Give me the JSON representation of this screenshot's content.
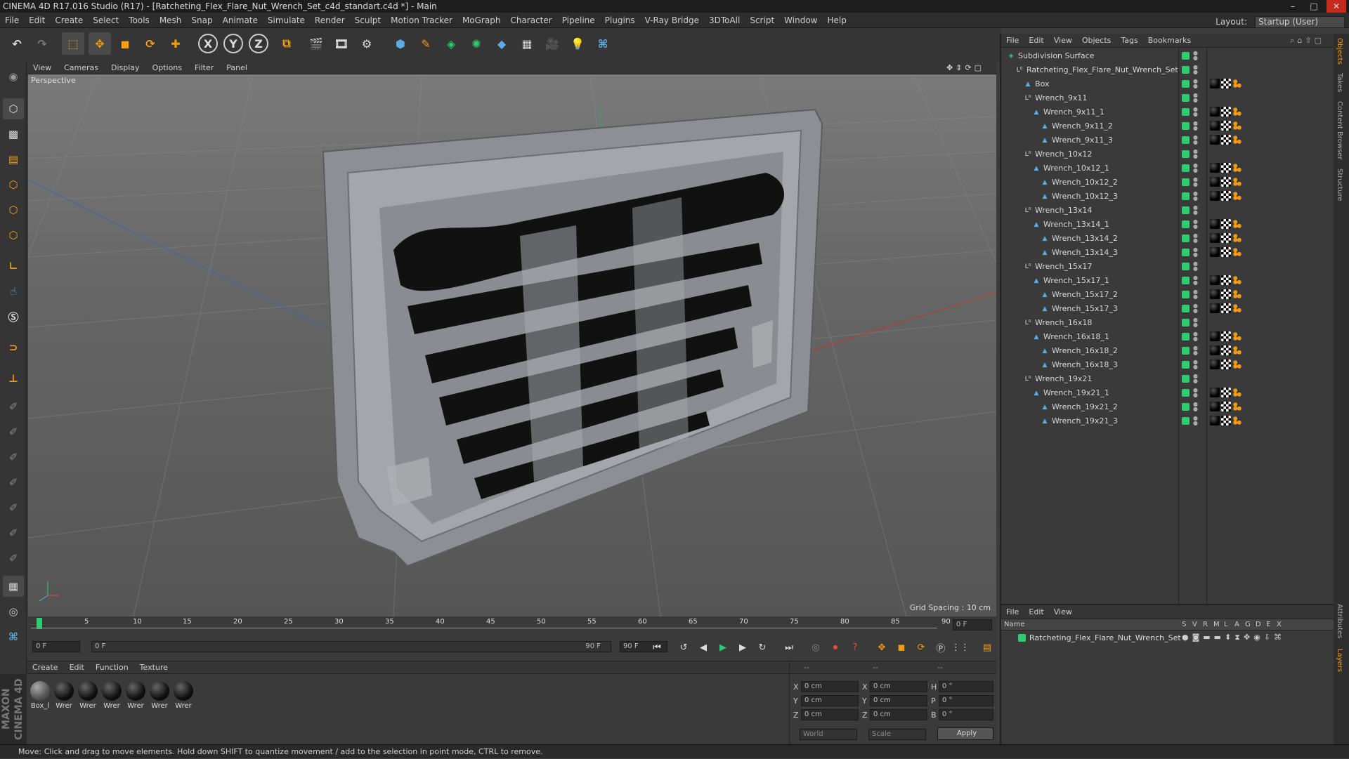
{
  "window": {
    "title": "CINEMA 4D R17.016 Studio (R17) - [Ratcheting_Flex_Flare_Nut_Wrench_Set_c4d_standart.c4d *] - Main",
    "controls": [
      "–",
      "□",
      "✕"
    ]
  },
  "menubar": {
    "items": [
      "File",
      "Edit",
      "Create",
      "Select",
      "Tools",
      "Mesh",
      "Snap",
      "Animate",
      "Simulate",
      "Render",
      "Sculpt",
      "Motion Tracker",
      "MoGraph",
      "Character",
      "Pipeline",
      "Plugins",
      "V-Ray Bridge",
      "3DToAll",
      "Script",
      "Window",
      "Help"
    ],
    "layout_label": "Layout:",
    "layout_value": "Startup (User)"
  },
  "toolbar": {
    "axis_x": "X",
    "axis_y": "Y",
    "axis_z": "Z"
  },
  "viewport": {
    "menu": [
      "View",
      "Cameras",
      "Display",
      "Options",
      "Filter",
      "Panel"
    ],
    "label": "Perspective",
    "grid_spacing": "Grid Spacing : 10 cm"
  },
  "timeline": {
    "ticks": [
      "0",
      "5",
      "10",
      "15",
      "20",
      "25",
      "30",
      "35",
      "40",
      "45",
      "50",
      "55",
      "60",
      "65",
      "70",
      "75",
      "80",
      "85",
      "90"
    ],
    "current_frame": "0 F",
    "start_field": "0 F",
    "range_start": "0 F",
    "range_end": "90 F",
    "end_field": "90 F"
  },
  "material_panel": {
    "menu": [
      "Create",
      "Edit",
      "Function",
      "Texture"
    ],
    "materials": [
      "Box_l",
      "Wrer",
      "Wrer",
      "Wrer",
      "Wrer",
      "Wrer",
      "Wrer"
    ]
  },
  "coords": {
    "headers": [
      "--",
      "--",
      "--"
    ],
    "rows": [
      {
        "a": "X",
        "av": "0 cm",
        "b": "X",
        "bv": "0 cm",
        "c": "H",
        "cv": "0 °"
      },
      {
        "a": "Y",
        "av": "0 cm",
        "b": "Y",
        "bv": "0 cm",
        "c": "P",
        "cv": "0 °"
      },
      {
        "a": "Z",
        "av": "0 cm",
        "b": "Z",
        "bv": "0 cm",
        "c": "B",
        "cv": "0 °"
      }
    ],
    "space": "World",
    "mode": "Scale",
    "apply": "Apply"
  },
  "objects_panel": {
    "menu": [
      "File",
      "Edit",
      "View",
      "Objects",
      "Tags",
      "Bookmarks"
    ],
    "items": [
      {
        "name": "Subdivision Surface",
        "depth": 0,
        "kind": "subdiv",
        "tags": []
      },
      {
        "name": "Ratcheting_Flex_Flare_Nut_Wrench_Set",
        "depth": 1,
        "kind": "null",
        "tags": []
      },
      {
        "name": "Box",
        "depth": 2,
        "kind": "poly",
        "tags": [
          "m",
          "c",
          "o"
        ]
      },
      {
        "name": "Wrench_9x11",
        "depth": 2,
        "kind": "null",
        "tags": []
      },
      {
        "name": "Wrench_9x11_1",
        "depth": 3,
        "kind": "poly",
        "tags": [
          "m",
          "c",
          "o"
        ]
      },
      {
        "name": "Wrench_9x11_2",
        "depth": 4,
        "kind": "poly",
        "tags": [
          "m",
          "c",
          "o"
        ]
      },
      {
        "name": "Wrench_9x11_3",
        "depth": 4,
        "kind": "poly",
        "tags": [
          "m",
          "c",
          "o"
        ]
      },
      {
        "name": "Wrench_10x12",
        "depth": 2,
        "kind": "null",
        "tags": []
      },
      {
        "name": "Wrench_10x12_1",
        "depth": 3,
        "kind": "poly",
        "tags": [
          "m",
          "c",
          "o"
        ]
      },
      {
        "name": "Wrench_10x12_2",
        "depth": 4,
        "kind": "poly",
        "tags": [
          "m",
          "c",
          "o"
        ]
      },
      {
        "name": "Wrench_10x12_3",
        "depth": 4,
        "kind": "poly",
        "tags": [
          "m",
          "c",
          "o"
        ]
      },
      {
        "name": "Wrench_13x14",
        "depth": 2,
        "kind": "null",
        "tags": []
      },
      {
        "name": "Wrench_13x14_1",
        "depth": 3,
        "kind": "poly",
        "tags": [
          "m",
          "c",
          "o"
        ]
      },
      {
        "name": "Wrench_13x14_2",
        "depth": 4,
        "kind": "poly",
        "tags": [
          "m",
          "c",
          "o"
        ]
      },
      {
        "name": "Wrench_13x14_3",
        "depth": 4,
        "kind": "poly",
        "tags": [
          "m",
          "c",
          "o"
        ]
      },
      {
        "name": "Wrench_15x17",
        "depth": 2,
        "kind": "null",
        "tags": []
      },
      {
        "name": "Wrench_15x17_1",
        "depth": 3,
        "kind": "poly",
        "tags": [
          "m",
          "c",
          "o"
        ]
      },
      {
        "name": "Wrench_15x17_2",
        "depth": 4,
        "kind": "poly",
        "tags": [
          "m",
          "c",
          "o"
        ]
      },
      {
        "name": "Wrench_15x17_3",
        "depth": 4,
        "kind": "poly",
        "tags": [
          "m",
          "c",
          "o"
        ]
      },
      {
        "name": "Wrench_16x18",
        "depth": 2,
        "kind": "null",
        "tags": []
      },
      {
        "name": "Wrench_16x18_1",
        "depth": 3,
        "kind": "poly",
        "tags": [
          "m",
          "c",
          "o"
        ]
      },
      {
        "name": "Wrench_16x18_2",
        "depth": 4,
        "kind": "poly",
        "tags": [
          "m",
          "c",
          "o"
        ]
      },
      {
        "name": "Wrench_16x18_3",
        "depth": 4,
        "kind": "poly",
        "tags": [
          "m",
          "c",
          "o"
        ]
      },
      {
        "name": "Wrench_19x21",
        "depth": 2,
        "kind": "null",
        "tags": []
      },
      {
        "name": "Wrench_19x21_1",
        "depth": 3,
        "kind": "poly",
        "tags": [
          "m",
          "c",
          "o"
        ]
      },
      {
        "name": "Wrench_19x21_2",
        "depth": 4,
        "kind": "poly",
        "tags": [
          "m",
          "c",
          "o"
        ]
      },
      {
        "name": "Wrench_19x21_3",
        "depth": 4,
        "kind": "poly",
        "tags": [
          "m",
          "c",
          "o"
        ]
      }
    ]
  },
  "layers_panel": {
    "menu": [
      "File",
      "Edit",
      "View"
    ],
    "columns": [
      "Name",
      "S",
      "V",
      "R",
      "M",
      "L",
      "A",
      "G",
      "D",
      "E",
      "X"
    ],
    "layers": [
      {
        "name": "Ratcheting_Flex_Flare_Nut_Wrench_Set",
        "color": "#2ecc71"
      }
    ]
  },
  "side_tabs": [
    "Objects",
    "Takes",
    "Content Browser",
    "Structure",
    "Attributes",
    "Layers"
  ],
  "brand": {
    "line1": "MAXON",
    "line2": "CINEMA 4D"
  },
  "status": "Move: Click and drag to move elements. Hold down SHIFT to quantize movement / add to the selection in point mode, CTRL to remove.",
  "colors": {
    "accent": "#2ecc71",
    "toolbar_icon": "#f39c12",
    "viewport_bg": "#6e6e6e"
  }
}
